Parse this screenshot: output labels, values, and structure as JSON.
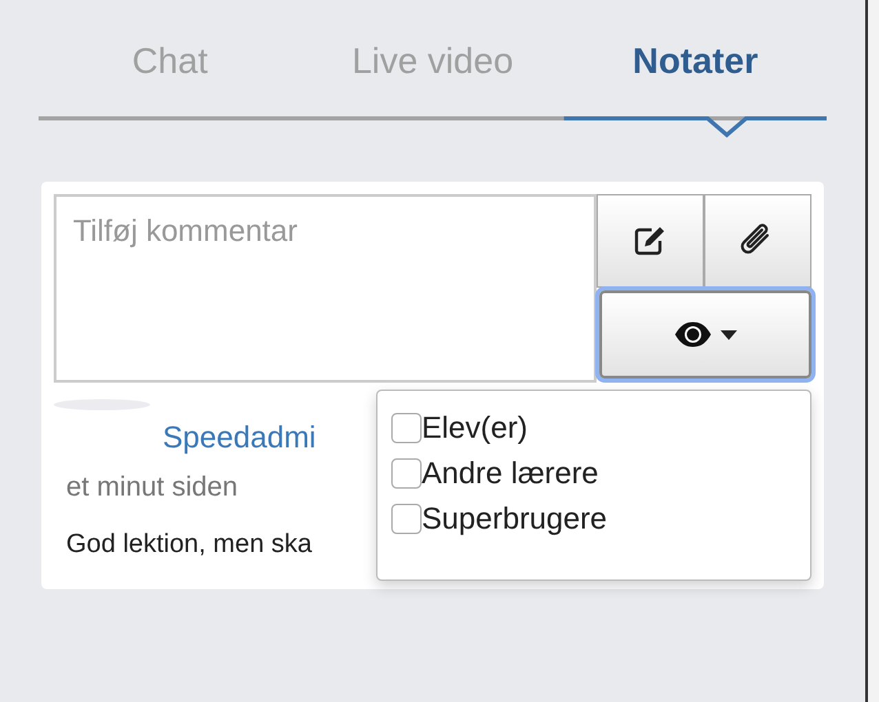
{
  "tabs": [
    {
      "label": "Chat",
      "selected": false
    },
    {
      "label": "Live video",
      "selected": false
    },
    {
      "label": "Notater",
      "selected": true
    }
  ],
  "comment_field": {
    "placeholder": "Tilføj kommentar"
  },
  "visibility_menu": {
    "expanded": true,
    "options": [
      {
        "label": "Elev(er)",
        "checked": false
      },
      {
        "label": "Andre lærere",
        "checked": false
      },
      {
        "label": "Superbrugere",
        "checked": false
      }
    ]
  },
  "note": {
    "author": "Speedadmi",
    "time": "et minut siden",
    "text": "God lektion, men ska"
  }
}
